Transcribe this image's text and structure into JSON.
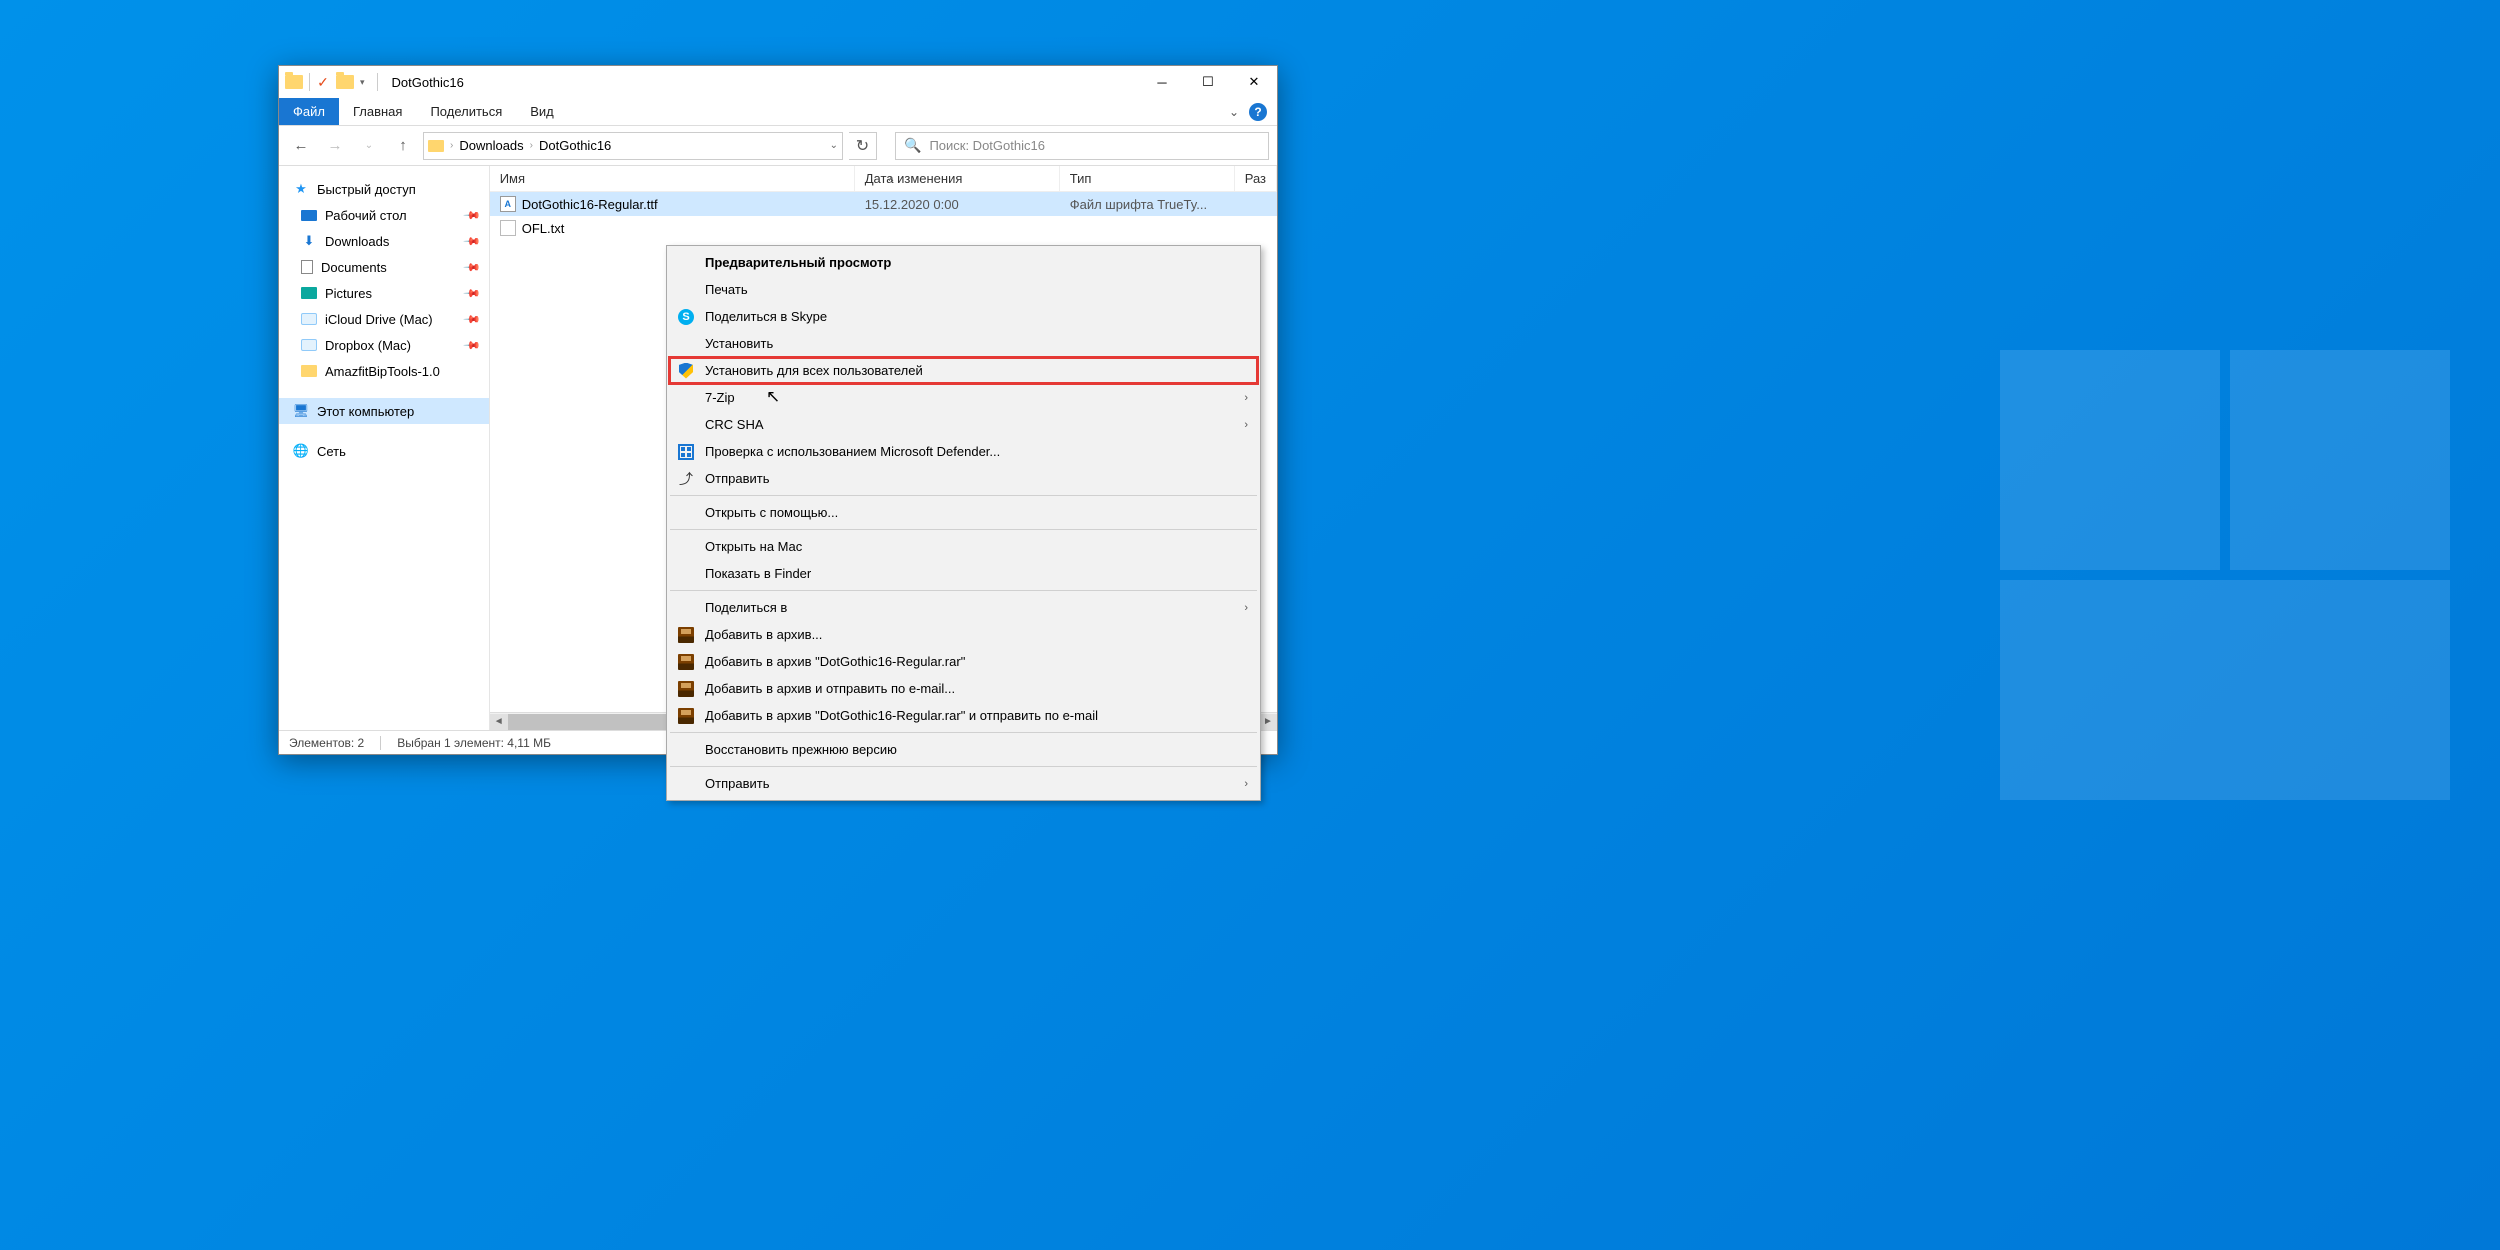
{
  "window": {
    "title": "DotGothic16"
  },
  "ribbon": {
    "file": "Файл",
    "home": "Главная",
    "share": "Поделиться",
    "view": "Вид"
  },
  "breadcrumb": {
    "seg1": "Downloads",
    "seg2": "DotGothic16"
  },
  "search": {
    "placeholder": "Поиск: DotGothic16"
  },
  "nav": {
    "quick": "Быстрый доступ",
    "desktop": "Рабочий стол",
    "downloads": "Downloads",
    "documents": "Documents",
    "pictures": "Pictures",
    "icloud": "iCloud Drive (Mac)",
    "dropbox": "Dropbox (Mac)",
    "amazfit": "AmazfitBipTools-1.0",
    "thispc": "Этот компьютер",
    "network": "Сеть"
  },
  "columns": {
    "name": "Имя",
    "date": "Дата изменения",
    "type": "Тип",
    "size": "Раз"
  },
  "files": {
    "row0": {
      "name": "DotGothic16-Regular.ttf",
      "date": "15.12.2020 0:00",
      "type": "Файл шрифта TrueTy..."
    },
    "row1": {
      "name": "OFL.txt"
    }
  },
  "status": {
    "items": "Элементов: 2",
    "selection": "Выбран 1 элемент: 4,11 МБ"
  },
  "ctx": {
    "preview": "Предварительный просмотр",
    "print": "Печать",
    "skype": "Поделиться в Skype",
    "install": "Установить",
    "install_all": "Установить для всех пользователей",
    "zip": "7-Zip",
    "crc": "CRC SHA",
    "defender": "Проверка с использованием Microsoft Defender...",
    "send": "Отправить",
    "openwith": "Открыть с помощью...",
    "openmac": "Открыть на Mac",
    "finder": "Показать в Finder",
    "sharein": "Поделиться в",
    "addarchive": "Добавить в архив...",
    "addrar": "Добавить в архив \"DotGothic16-Regular.rar\"",
    "addemail": "Добавить в архив и отправить по e-mail...",
    "addraremail": "Добавить в архив \"DotGothic16-Regular.rar\" и отправить по e-mail",
    "restore": "Восстановить прежнюю версию",
    "send2": "Отправить"
  }
}
